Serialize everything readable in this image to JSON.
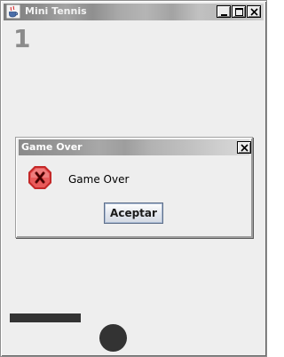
{
  "window": {
    "title": "Mini Tennis",
    "icon": "java-cup-icon",
    "controls": [
      "minimize-icon",
      "maximize-icon",
      "close-icon"
    ]
  },
  "game": {
    "score": "1"
  },
  "dialog": {
    "title": "Game Over",
    "icon": "error-x-icon",
    "message": "Game Over",
    "ok_label": "Aceptar"
  },
  "colors": {
    "background": "#eeeeee",
    "score": "#8b8b8b",
    "game_objects": "#333333",
    "error_icon": "#e23a3a"
  }
}
